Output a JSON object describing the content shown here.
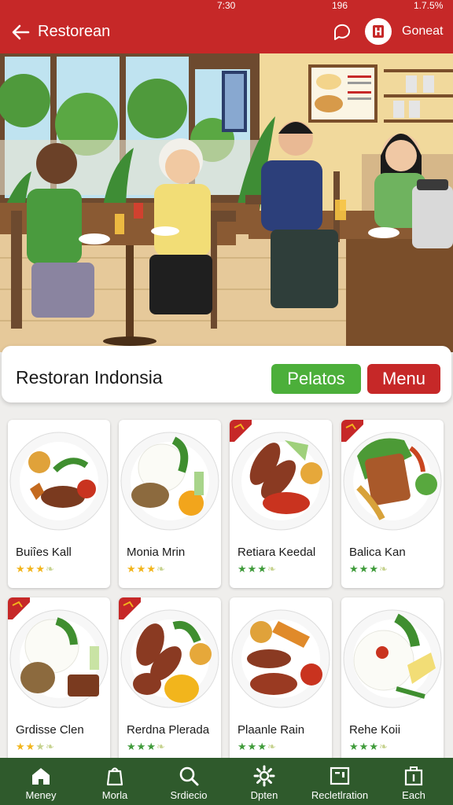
{
  "status": {
    "time": "7:30",
    "battery": "1.7.5%",
    "signal": "196"
  },
  "appbar": {
    "title": "Restorean",
    "account_label": "Goneat"
  },
  "restaurant": {
    "name": "Restoran Indonsia",
    "btn_primary": "Pelatos",
    "btn_menu": "Menu"
  },
  "dishes": [
    {
      "name": "Buiîes Kall",
      "rating": 3
    },
    {
      "name": "Monia Mrin",
      "rating": 3
    },
    {
      "name": "Retiara Keedal",
      "rating": 3
    },
    {
      "name": "Balica Kan",
      "rating": 3
    },
    {
      "name": "Grdisse Clen",
      "rating": 2
    },
    {
      "name": "Rerdna Plerada",
      "rating": 3
    },
    {
      "name": "Plaanle Rain",
      "rating": 3
    },
    {
      "name": "Rehe Koii",
      "rating": 3
    }
  ],
  "nav": [
    {
      "label": "Meney",
      "icon": "home-icon"
    },
    {
      "label": "Morla",
      "icon": "bag-icon"
    },
    {
      "label": "Srdiecio",
      "icon": "search-icon"
    },
    {
      "label": "Dpten",
      "icon": "gear-icon"
    },
    {
      "label": "Recletlration",
      "icon": "register-icon"
    },
    {
      "label": "Each",
      "icon": "info-icon"
    }
  ],
  "colors": {
    "brand_red": "#c62828",
    "accent_green": "#4caf3a",
    "nav_green": "#2f5a2c"
  }
}
